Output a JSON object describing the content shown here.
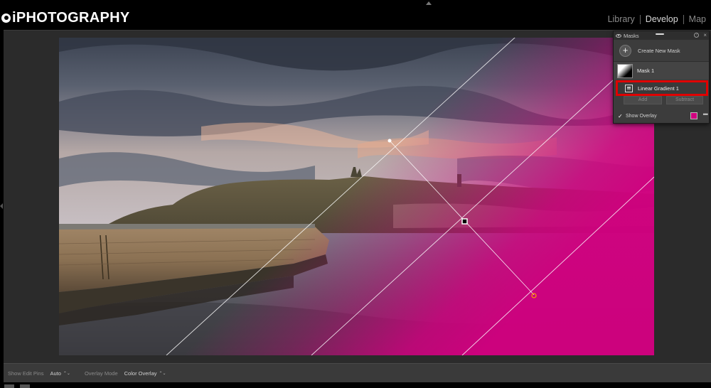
{
  "brand": {
    "name": "iPHOTOGRAPHY"
  },
  "modules": [
    {
      "label": "Library",
      "active": false
    },
    {
      "label": "Develop",
      "active": true
    },
    {
      "label": "Map",
      "active": false
    }
  ],
  "masks_panel": {
    "title": "Masks",
    "help_glyph": "?",
    "close_glyph": "×",
    "create_label": "Create New Mask",
    "plus_glyph": "+",
    "mask_name": "Mask 1",
    "component_name": "Linear Gradient 1",
    "add_label": "Add",
    "subtract_label": "Subtract",
    "show_overlay_label": "Show Overlay",
    "show_overlay_checked": true,
    "overlay_color": "#d0007f",
    "more_glyph": "•••"
  },
  "toolbar": {
    "edit_pins_label": "Show Edit Pins",
    "edit_pins_value": "Auto",
    "overlay_mode_label": "Overlay Mode",
    "overlay_mode_value": "Color Overlay",
    "updown_glyph": "⌃⌄"
  },
  "colors": {
    "highlight_border": "#e00000",
    "overlay_magenta": "#d0007f",
    "gradient_pin": "#ff9900"
  },
  "icons": [
    "eye-icon",
    "help-icon",
    "close-icon",
    "plus-icon",
    "mask-thumbnail",
    "linear-gradient-icon",
    "checkbox-icon",
    "more-icon"
  ]
}
